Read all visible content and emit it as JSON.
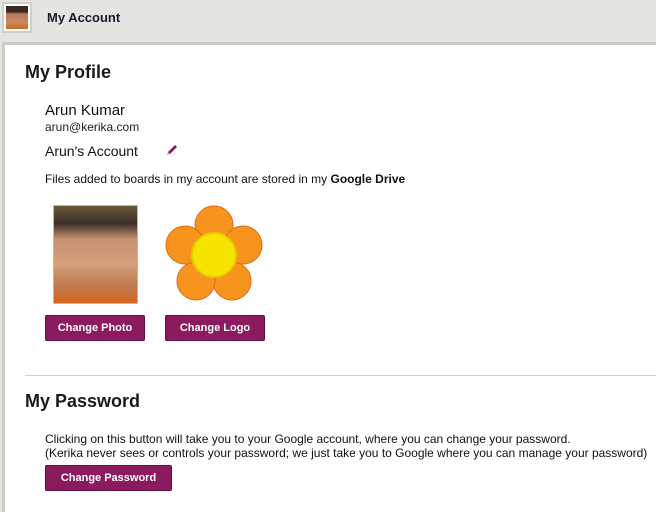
{
  "header": {
    "title": "My Account"
  },
  "profile": {
    "heading": "My Profile",
    "name": "Arun Kumar",
    "email": "arun@kerika.com",
    "account_name": "Arun's Account",
    "storage_prefix": "Files added to boards in my account are stored in my ",
    "storage_target": "Google Drive",
    "change_photo_label": "Change Photo",
    "change_logo_label": "Change Logo"
  },
  "password": {
    "heading": "My Password",
    "line1": "Clicking on this button will take you to your Google account, where you can change your password.",
    "line2": "(Kerika never sees or controls your password; we just take you to Google where you can manage your password)",
    "change_password_label": "Change Password"
  },
  "colors": {
    "button": "#8b1a5f",
    "header_bg": "#e4e5e0",
    "logo_petal": "#f7941d",
    "logo_center": "#f4e400"
  }
}
